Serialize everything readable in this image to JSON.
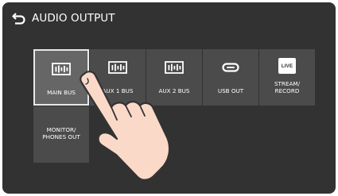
{
  "header": {
    "title": "AUDIO OUTPUT",
    "back_icon": "return-arrow-icon"
  },
  "tiles": [
    {
      "label": "MAIN BUS",
      "icon": "audio-bus-icon",
      "selected": true
    },
    {
      "label": "AUX 1 BUS",
      "icon": "audio-bus-icon",
      "selected": false
    },
    {
      "label": "AUX 2 BUS",
      "icon": "audio-bus-icon",
      "selected": false
    },
    {
      "label": "USB OUT",
      "icon": "usb-c-icon",
      "selected": false
    },
    {
      "label": "STREAM/\nRECORD",
      "icon": "live-icon",
      "icon_text": "LIVE",
      "selected": false
    },
    {
      "label": "MONITOR/\nPHONES OUT",
      "icon": "",
      "selected": false
    }
  ],
  "colors": {
    "screen_bg": "#323232",
    "tile_bg": "#4b4b4b",
    "tile_selected_bg": "#666666",
    "tile_selected_border": "#e8e8e8",
    "text": "#ffffff",
    "hand_fill": "#fbd9c8",
    "hand_stroke": "#333333"
  }
}
